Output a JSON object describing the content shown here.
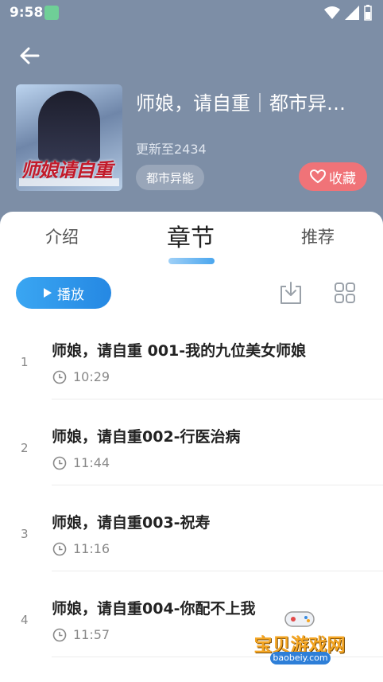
{
  "status_bar": {
    "time": "9:58"
  },
  "book": {
    "title": "师娘，请自重｜都市异…",
    "update": "更新至2434",
    "genre": "都市异能",
    "favorite_label": "收藏",
    "cover_text": "师娘请自重"
  },
  "tabs": [
    {
      "label": "介绍"
    },
    {
      "label": "章节",
      "active": true
    },
    {
      "label": "推荐"
    }
  ],
  "actions": {
    "play_label": "播放"
  },
  "chapters": [
    {
      "num": "1",
      "title": "师娘，请自重 001-我的九位美女师娘",
      "duration": "10:29"
    },
    {
      "num": "2",
      "title": "师娘，请自重002-行医治病",
      "duration": "11:44"
    },
    {
      "num": "3",
      "title": "师娘，请自重003-祝寿",
      "duration": "11:16"
    },
    {
      "num": "4",
      "title": "师娘，请自重004-你配不上我",
      "duration": "11:57"
    }
  ],
  "watermark": {
    "text": "宝贝游戏网",
    "url": "baobeiy.com"
  },
  "colors": {
    "header": "#7d8ea6",
    "accent": "#2588e3",
    "favorite": "#f07378"
  }
}
